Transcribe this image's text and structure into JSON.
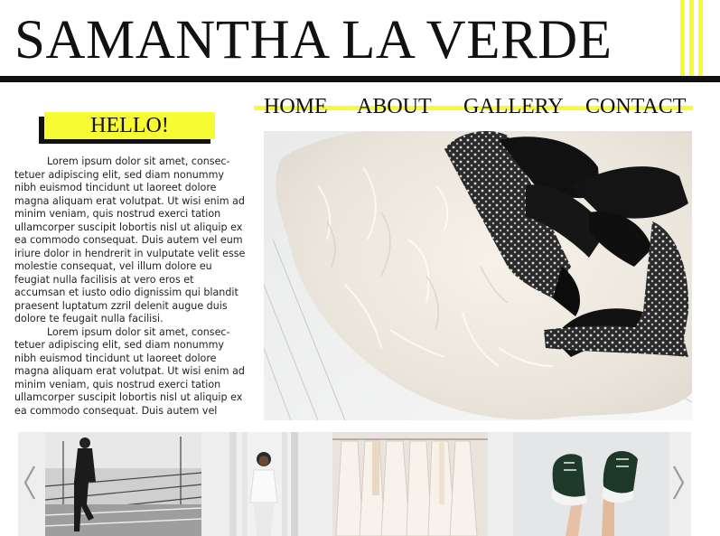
{
  "site": {
    "title": "SAMANTHA LA VERDE"
  },
  "colors": {
    "accent": "#f7fb33",
    "ink": "#111111",
    "strip": "#eeeeee"
  },
  "nav": {
    "items": [
      "HOME",
      "ABOUT",
      "GALLERY",
      "CONTACT"
    ]
  },
  "hello": {
    "label": "HELLO!"
  },
  "content": {
    "paragraphs": [
      "Lorem ipsum dolor sit amet, consec-tetuer adipiscing elit, sed diam nonummy nibh euismod tincidunt ut laoreet dolore magna aliquam erat volutpat. Ut wisi enim ad minim veniam, quis nostrud exerci tation ullamcorper suscipit lobortis nisl ut aliquip ex ea commodo consequat. Duis autem vel eum iriure dolor in hendrerit in vulputate velit esse molestie consequat, vel illum dolore eu feugiat nulla facilisis at vero eros et accumsan et iusto odio dignissim qui blandit praesent luptatum zzril delenit augue duis dolore te feugait nulla facilisi.",
      "Lorem ipsum dolor sit amet, consec-tetuer adipiscing elit, sed diam nonummy nibh euismod tincidunt ut laoreet dolore magna aliquam erat volutpat. Ut wisi enim ad minim veniam, quis nostrud exerci tation ullamcorper suscipit lobortis nisl ut aliquip ex ea commodo consequat. Duis autem vel"
    ]
  },
  "hero": {
    "image": "fur-rug-black-wedge-sandals-photo"
  },
  "gallery": {
    "thumbnails": [
      "woman-on-stairs-bw-photo",
      "woman-white-blazer-photo",
      "white-dresses-on-rack-photo",
      "green-high-top-sneakers-photo"
    ],
    "prev_icon": "chevron-left-icon",
    "next_icon": "chevron-right-icon"
  }
}
